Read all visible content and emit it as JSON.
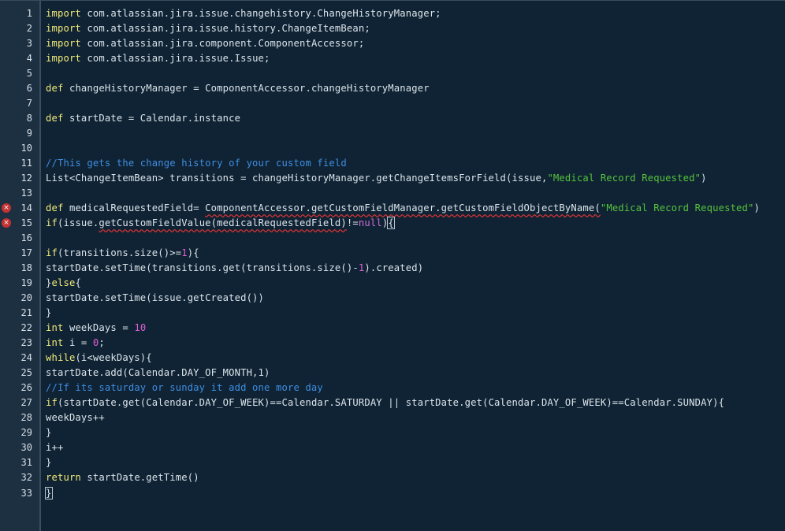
{
  "editor": {
    "language": "groovy",
    "colors": {
      "background": "#0f2334",
      "gutter": "#1c3042",
      "keyword": "#f3ea7a",
      "comment": "#3f8de0",
      "string": "#57c23c",
      "number": "#e05ed2",
      "error_marker": "#c43232"
    },
    "error_marker_glyph": "×",
    "lines": [
      {
        "n": "1",
        "error": false,
        "tokens": [
          {
            "t": "kw",
            "v": "import"
          },
          {
            "t": "pl",
            "v": " com.atlassian.jira.issue.changehistory.ChangeHistoryManager;"
          }
        ]
      },
      {
        "n": "2",
        "error": false,
        "tokens": [
          {
            "t": "kw",
            "v": "import"
          },
          {
            "t": "pl",
            "v": " com.atlassian.jira.issue.history.ChangeItemBean;"
          }
        ]
      },
      {
        "n": "3",
        "error": false,
        "tokens": [
          {
            "t": "kw",
            "v": "import"
          },
          {
            "t": "pl",
            "v": " com.atlassian.jira.component.ComponentAccessor;"
          }
        ]
      },
      {
        "n": "4",
        "error": false,
        "tokens": [
          {
            "t": "kw",
            "v": "import"
          },
          {
            "t": "pl",
            "v": " com.atlassian.jira.issue.Issue;"
          }
        ]
      },
      {
        "n": "5",
        "error": false,
        "tokens": []
      },
      {
        "n": "6",
        "error": false,
        "tokens": [
          {
            "t": "kw",
            "v": "def"
          },
          {
            "t": "pl",
            "v": " changeHistoryManager = ComponentAccessor.changeHistoryManager"
          }
        ]
      },
      {
        "n": "7",
        "error": false,
        "tokens": []
      },
      {
        "n": "8",
        "error": false,
        "tokens": [
          {
            "t": "kw",
            "v": "def"
          },
          {
            "t": "pl",
            "v": " startDate = Calendar.instance"
          }
        ]
      },
      {
        "n": "9",
        "error": false,
        "tokens": []
      },
      {
        "n": "10",
        "error": false,
        "tokens": []
      },
      {
        "n": "11",
        "error": false,
        "tokens": [
          {
            "t": "cm",
            "v": "//This gets the change history of your custom field"
          }
        ]
      },
      {
        "n": "12",
        "error": false,
        "tokens": [
          {
            "t": "pl",
            "v": "List<ChangeItemBean> transitions = changeHistoryManager.getChangeItemsForField(issue,"
          },
          {
            "t": "st",
            "v": "\"Medical Record Requested\""
          },
          {
            "t": "pl",
            "v": ")"
          }
        ]
      },
      {
        "n": "13",
        "error": false,
        "tokens": []
      },
      {
        "n": "14",
        "error": true,
        "tokens": [
          {
            "t": "kw",
            "v": "def"
          },
          {
            "t": "pl",
            "v": " medicalRequestedField= "
          },
          {
            "t": "sq",
            "v": "ComponentAccessor.getCustomFieldManager.getCustomFieldObjectByName("
          },
          {
            "t": "st",
            "v": "\"Medical Record Requested\""
          },
          {
            "t": "pl",
            "v": ")"
          }
        ]
      },
      {
        "n": "15",
        "error": true,
        "tokens": [
          {
            "t": "kw",
            "v": "if"
          },
          {
            "t": "pl",
            "v": "(issue."
          },
          {
            "t": "sq",
            "v": "getCustomFieldValue(medicalRequestedField)"
          },
          {
            "t": "pl",
            "v": "!="
          },
          {
            "t": "nl",
            "v": "null"
          },
          {
            "t": "pl",
            "v": ")"
          },
          {
            "t": "caret",
            "v": "{"
          }
        ]
      },
      {
        "n": "16",
        "error": false,
        "tokens": []
      },
      {
        "n": "17",
        "error": false,
        "tokens": [
          {
            "t": "kw",
            "v": "if"
          },
          {
            "t": "pl",
            "v": "(transitions.size()>="
          },
          {
            "t": "num",
            "v": "1"
          },
          {
            "t": "pl",
            "v": "){"
          }
        ]
      },
      {
        "n": "18",
        "error": false,
        "tokens": [
          {
            "t": "pl",
            "v": "startDate.setTime(transitions.get(transitions.size()-"
          },
          {
            "t": "num",
            "v": "1"
          },
          {
            "t": "pl",
            "v": ").created)"
          }
        ]
      },
      {
        "n": "19",
        "error": false,
        "tokens": [
          {
            "t": "pl",
            "v": "}"
          },
          {
            "t": "kw",
            "v": "else"
          },
          {
            "t": "pl",
            "v": "{"
          }
        ]
      },
      {
        "n": "20",
        "error": false,
        "tokens": [
          {
            "t": "pl",
            "v": "startDate.setTime(issue.getCreated())"
          }
        ]
      },
      {
        "n": "21",
        "error": false,
        "tokens": [
          {
            "t": "pl",
            "v": "}"
          }
        ]
      },
      {
        "n": "22",
        "error": false,
        "tokens": [
          {
            "t": "kw",
            "v": "int"
          },
          {
            "t": "pl",
            "v": " weekDays = "
          },
          {
            "t": "num",
            "v": "10"
          }
        ]
      },
      {
        "n": "23",
        "error": false,
        "tokens": [
          {
            "t": "kw",
            "v": "int"
          },
          {
            "t": "pl",
            "v": " i = "
          },
          {
            "t": "num",
            "v": "0"
          },
          {
            "t": "pl",
            "v": ";"
          }
        ]
      },
      {
        "n": "24",
        "error": false,
        "tokens": [
          {
            "t": "kw",
            "v": "while"
          },
          {
            "t": "pl",
            "v": "(i<weekDays){"
          }
        ]
      },
      {
        "n": "25",
        "error": false,
        "tokens": [
          {
            "t": "pl",
            "v": "startDate.add(Calendar.DAY_OF_MONTH,1)"
          }
        ]
      },
      {
        "n": "26",
        "error": false,
        "tokens": [
          {
            "t": "cm",
            "v": "//If its saturday or sunday it add one more day"
          }
        ]
      },
      {
        "n": "27",
        "error": false,
        "tokens": [
          {
            "t": "kw",
            "v": "if"
          },
          {
            "t": "pl",
            "v": "(startDate.get(Calendar.DAY_OF_WEEK)==Calendar.SATURDAY || startDate.get(Calendar.DAY_OF_WEEK)==Calendar.SUNDAY){"
          }
        ]
      },
      {
        "n": "28",
        "error": false,
        "tokens": [
          {
            "t": "pl",
            "v": "weekDays++"
          }
        ]
      },
      {
        "n": "29",
        "error": false,
        "tokens": [
          {
            "t": "pl",
            "v": "}"
          }
        ]
      },
      {
        "n": "30",
        "error": false,
        "tokens": [
          {
            "t": "pl",
            "v": "i++"
          }
        ]
      },
      {
        "n": "31",
        "error": false,
        "tokens": [
          {
            "t": "pl",
            "v": "}"
          }
        ]
      },
      {
        "n": "32",
        "error": false,
        "tokens": [
          {
            "t": "kw",
            "v": "return"
          },
          {
            "t": "pl",
            "v": " startDate.getTime()"
          }
        ]
      },
      {
        "n": "33",
        "error": false,
        "tokens": [
          {
            "t": "caret",
            "v": "}"
          }
        ]
      }
    ]
  }
}
